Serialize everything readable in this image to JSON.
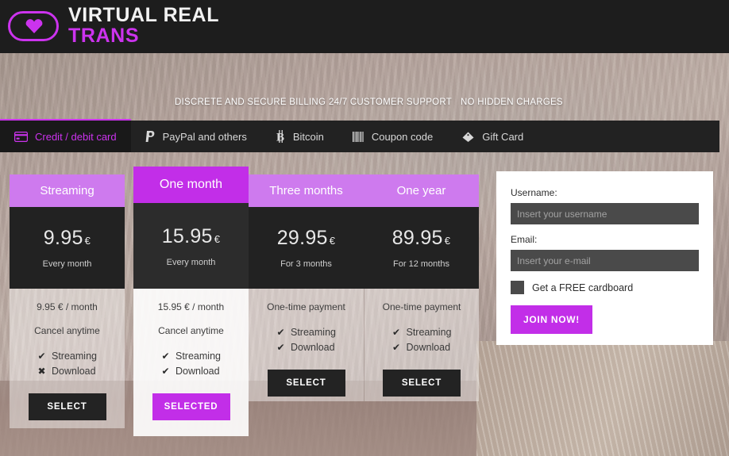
{
  "brand": {
    "line1": "VIRTUAL REAL",
    "line2": "TRANS",
    "logo_icon": "heart-in-pill-icon",
    "accent": "#cc33ee"
  },
  "promo": {
    "items": [
      "DISCRETE AND SECURE BILLING",
      "24/7 CUSTOMER SUPPORT",
      "NO HIDDEN CHARGES"
    ]
  },
  "tabs": [
    {
      "label": "Credit / debit card",
      "icon": "credit-card-icon",
      "active": true
    },
    {
      "label": "PayPal and others",
      "icon": "paypal-icon",
      "active": false
    },
    {
      "label": "Bitcoin",
      "icon": "bitcoin-icon",
      "active": false
    },
    {
      "label": "Coupon code",
      "icon": "barcode-icon",
      "active": false
    },
    {
      "label": "Gift Card",
      "icon": "gift-tag-icon",
      "active": false
    }
  ],
  "pricing": {
    "plans": [
      {
        "title": "Streaming",
        "price": "9.95",
        "currency": "€",
        "period": "Every month",
        "note": "9.95 € / month",
        "cancel": "Cancel anytime",
        "features": [
          {
            "label": "Streaming",
            "mark": "✔",
            "included": true
          },
          {
            "label": "Download",
            "mark": "✖",
            "included": false
          }
        ],
        "button": "SELECT",
        "selected": false
      },
      {
        "title": "One month",
        "price": "15.95",
        "currency": "€",
        "period": "Every month",
        "note": "15.95 € / month",
        "cancel": "Cancel anytime",
        "features": [
          {
            "label": "Streaming",
            "mark": "✔",
            "included": true
          },
          {
            "label": "Download",
            "mark": "✔",
            "included": true
          }
        ],
        "button": "SELECTED",
        "selected": true
      },
      {
        "title": "Three months",
        "price": "29.95",
        "currency": "€",
        "period": "For 3 months",
        "note": "One-time payment",
        "cancel": "",
        "features": [
          {
            "label": "Streaming",
            "mark": "✔",
            "included": true
          },
          {
            "label": "Download",
            "mark": "✔",
            "included": true
          }
        ],
        "button": "SELECT",
        "selected": false
      },
      {
        "title": "One year",
        "price": "89.95",
        "currency": "€",
        "period": "For 12 months",
        "note": "One-time payment",
        "cancel": "",
        "features": [
          {
            "label": "Streaming",
            "mark": "✔",
            "included": true
          },
          {
            "label": "Download",
            "mark": "✔",
            "included": true
          }
        ],
        "button": "SELECT",
        "selected": false
      }
    ]
  },
  "signup": {
    "username_label": "Username:",
    "username_value": "",
    "username_placeholder": "Insert your username",
    "email_label": "Email:",
    "email_value": "",
    "email_placeholder": "Insert your e-mail",
    "checkbox_label": "Get a FREE cardboard",
    "checkbox_checked": false,
    "submit_label": "JOIN NOW!"
  }
}
